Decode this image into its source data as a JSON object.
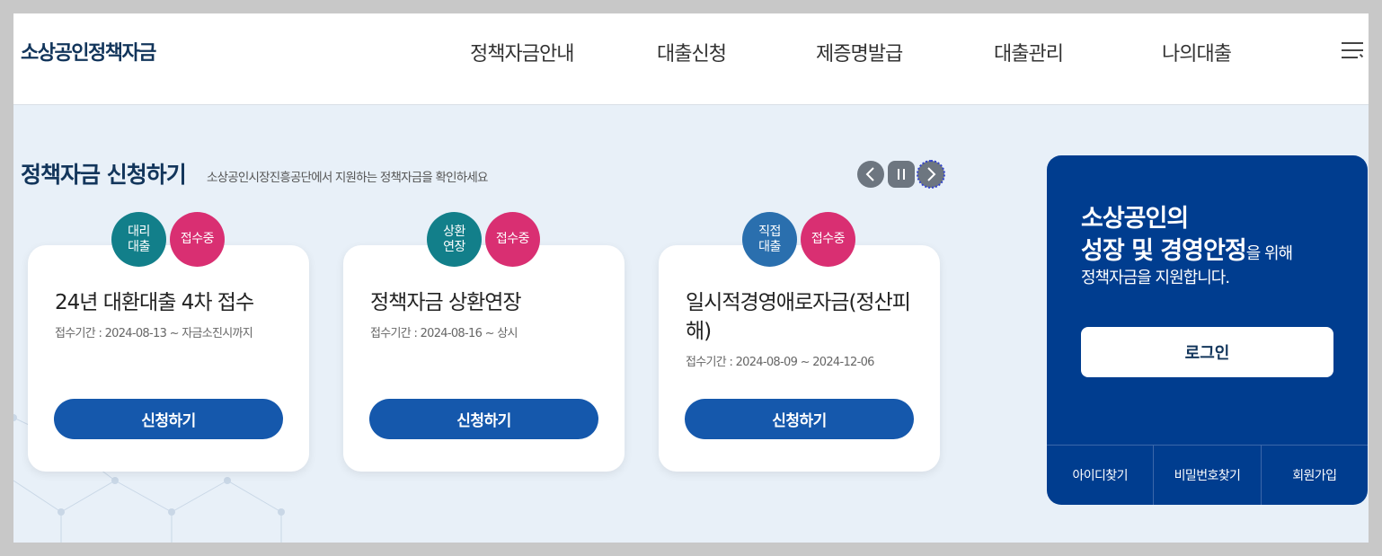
{
  "header": {
    "logo": "소상공인정책자금",
    "nav": [
      "정책자금안내",
      "대출신청",
      "제증명발급",
      "대출관리",
      "나의대출"
    ]
  },
  "section": {
    "title": "정책자금 신청하기",
    "subtitle": "소상공인시장진흥공단에서 지원하는 정책자금을 확인하세요"
  },
  "cards": [
    {
      "type_badge": [
        "대리",
        "대출"
      ],
      "status_badge": "접수중",
      "title": "24년 대환대출 4차 접수",
      "period": "접수기간 : 2024-08-13 ~ 자금소진시까지",
      "button": "신청하기"
    },
    {
      "type_badge": [
        "상환",
        "연장"
      ],
      "status_badge": "접수중",
      "title": "정책자금 상환연장",
      "period": "접수기간 : 2024-08-16 ~ 상시",
      "button": "신청하기"
    },
    {
      "type_badge": [
        "직접",
        "대출"
      ],
      "status_badge": "접수중",
      "title": "일시적경영애로자금(정산피해)",
      "period": "접수기간 : 2024-08-09 ~ 2024-12-06",
      "button": "신청하기"
    }
  ],
  "login": {
    "line1": "소상공인의",
    "line2_strong": "성장 및 경영안정",
    "line2_weak": "을 위해",
    "line3": "정책자금을 지원합니다.",
    "button": "로그인",
    "links": [
      "아이디찾기",
      "비밀번호찾기",
      "회원가입"
    ]
  },
  "colors": {
    "brand": "#12355b",
    "button": "#1558ac",
    "panel": "#003d8f",
    "badge_status": "#d92f72",
    "badge_type": "#127f8a"
  }
}
